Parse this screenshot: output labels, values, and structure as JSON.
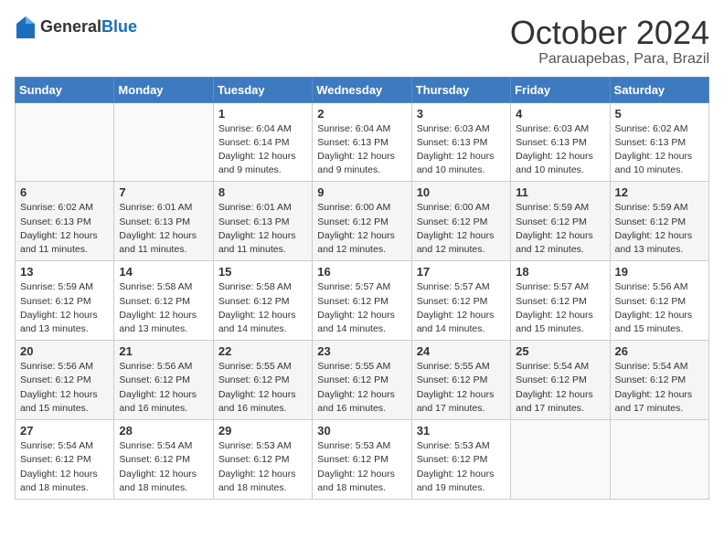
{
  "logo": {
    "text_general": "General",
    "text_blue": "Blue"
  },
  "header": {
    "month": "October 2024",
    "location": "Parauapebas, Para, Brazil"
  },
  "weekdays": [
    "Sunday",
    "Monday",
    "Tuesday",
    "Wednesday",
    "Thursday",
    "Friday",
    "Saturday"
  ],
  "weeks": [
    [
      {
        "day": "",
        "info": ""
      },
      {
        "day": "",
        "info": ""
      },
      {
        "day": "1",
        "info": "Sunrise: 6:04 AM\nSunset: 6:14 PM\nDaylight: 12 hours and 9 minutes."
      },
      {
        "day": "2",
        "info": "Sunrise: 6:04 AM\nSunset: 6:13 PM\nDaylight: 12 hours and 9 minutes."
      },
      {
        "day": "3",
        "info": "Sunrise: 6:03 AM\nSunset: 6:13 PM\nDaylight: 12 hours and 10 minutes."
      },
      {
        "day": "4",
        "info": "Sunrise: 6:03 AM\nSunset: 6:13 PM\nDaylight: 12 hours and 10 minutes."
      },
      {
        "day": "5",
        "info": "Sunrise: 6:02 AM\nSunset: 6:13 PM\nDaylight: 12 hours and 10 minutes."
      }
    ],
    [
      {
        "day": "6",
        "info": "Sunrise: 6:02 AM\nSunset: 6:13 PM\nDaylight: 12 hours and 11 minutes."
      },
      {
        "day": "7",
        "info": "Sunrise: 6:01 AM\nSunset: 6:13 PM\nDaylight: 12 hours and 11 minutes."
      },
      {
        "day": "8",
        "info": "Sunrise: 6:01 AM\nSunset: 6:13 PM\nDaylight: 12 hours and 11 minutes."
      },
      {
        "day": "9",
        "info": "Sunrise: 6:00 AM\nSunset: 6:12 PM\nDaylight: 12 hours and 12 minutes."
      },
      {
        "day": "10",
        "info": "Sunrise: 6:00 AM\nSunset: 6:12 PM\nDaylight: 12 hours and 12 minutes."
      },
      {
        "day": "11",
        "info": "Sunrise: 5:59 AM\nSunset: 6:12 PM\nDaylight: 12 hours and 12 minutes."
      },
      {
        "day": "12",
        "info": "Sunrise: 5:59 AM\nSunset: 6:12 PM\nDaylight: 12 hours and 13 minutes."
      }
    ],
    [
      {
        "day": "13",
        "info": "Sunrise: 5:59 AM\nSunset: 6:12 PM\nDaylight: 12 hours and 13 minutes."
      },
      {
        "day": "14",
        "info": "Sunrise: 5:58 AM\nSunset: 6:12 PM\nDaylight: 12 hours and 13 minutes."
      },
      {
        "day": "15",
        "info": "Sunrise: 5:58 AM\nSunset: 6:12 PM\nDaylight: 12 hours and 14 minutes."
      },
      {
        "day": "16",
        "info": "Sunrise: 5:57 AM\nSunset: 6:12 PM\nDaylight: 12 hours and 14 minutes."
      },
      {
        "day": "17",
        "info": "Sunrise: 5:57 AM\nSunset: 6:12 PM\nDaylight: 12 hours and 14 minutes."
      },
      {
        "day": "18",
        "info": "Sunrise: 5:57 AM\nSunset: 6:12 PM\nDaylight: 12 hours and 15 minutes."
      },
      {
        "day": "19",
        "info": "Sunrise: 5:56 AM\nSunset: 6:12 PM\nDaylight: 12 hours and 15 minutes."
      }
    ],
    [
      {
        "day": "20",
        "info": "Sunrise: 5:56 AM\nSunset: 6:12 PM\nDaylight: 12 hours and 15 minutes."
      },
      {
        "day": "21",
        "info": "Sunrise: 5:56 AM\nSunset: 6:12 PM\nDaylight: 12 hours and 16 minutes."
      },
      {
        "day": "22",
        "info": "Sunrise: 5:55 AM\nSunset: 6:12 PM\nDaylight: 12 hours and 16 minutes."
      },
      {
        "day": "23",
        "info": "Sunrise: 5:55 AM\nSunset: 6:12 PM\nDaylight: 12 hours and 16 minutes."
      },
      {
        "day": "24",
        "info": "Sunrise: 5:55 AM\nSunset: 6:12 PM\nDaylight: 12 hours and 17 minutes."
      },
      {
        "day": "25",
        "info": "Sunrise: 5:54 AM\nSunset: 6:12 PM\nDaylight: 12 hours and 17 minutes."
      },
      {
        "day": "26",
        "info": "Sunrise: 5:54 AM\nSunset: 6:12 PM\nDaylight: 12 hours and 17 minutes."
      }
    ],
    [
      {
        "day": "27",
        "info": "Sunrise: 5:54 AM\nSunset: 6:12 PM\nDaylight: 12 hours and 18 minutes."
      },
      {
        "day": "28",
        "info": "Sunrise: 5:54 AM\nSunset: 6:12 PM\nDaylight: 12 hours and 18 minutes."
      },
      {
        "day": "29",
        "info": "Sunrise: 5:53 AM\nSunset: 6:12 PM\nDaylight: 12 hours and 18 minutes."
      },
      {
        "day": "30",
        "info": "Sunrise: 5:53 AM\nSunset: 6:12 PM\nDaylight: 12 hours and 18 minutes."
      },
      {
        "day": "31",
        "info": "Sunrise: 5:53 AM\nSunset: 6:12 PM\nDaylight: 12 hours and 19 minutes."
      },
      {
        "day": "",
        "info": ""
      },
      {
        "day": "",
        "info": ""
      }
    ]
  ]
}
